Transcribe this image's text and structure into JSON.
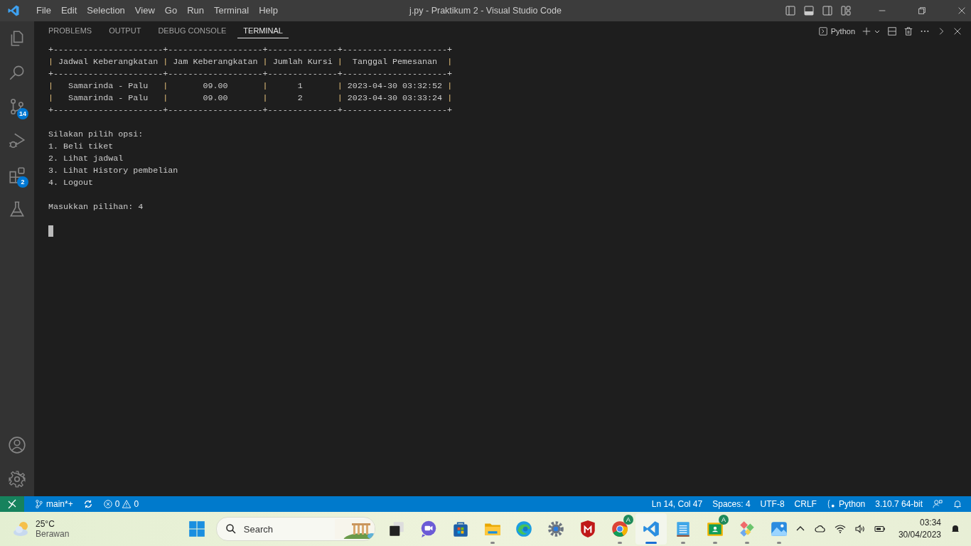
{
  "window": {
    "title": "j.py - Praktikum 2 - Visual Studio Code"
  },
  "menu": [
    "File",
    "Edit",
    "Selection",
    "View",
    "Go",
    "Run",
    "Terminal",
    "Help"
  ],
  "activity_bar": {
    "items": [
      {
        "kind": "explorer"
      },
      {
        "kind": "search"
      },
      {
        "kind": "source-control",
        "badge": "14"
      },
      {
        "kind": "run"
      },
      {
        "kind": "extensions",
        "badge": "2"
      },
      {
        "kind": "testing"
      }
    ],
    "bottom": [
      {
        "kind": "account"
      },
      {
        "kind": "settings"
      }
    ]
  },
  "panel_tabs": [
    {
      "label": "PROBLEMS",
      "selected": false
    },
    {
      "label": "OUTPUT",
      "selected": false
    },
    {
      "label": "DEBUG CONSOLE",
      "selected": false
    },
    {
      "label": "TERMINAL",
      "selected": true
    }
  ],
  "terminal_profile": "Python",
  "terminal": {
    "blocks": [
      [
        [
          {
            "kind": "plain",
            "text": "+----------------------+-------------------+--------------+---------------------+"
          }
        ],
        [
          {
            "kind": "border",
            "text": "|"
          },
          {
            "kind": "plain",
            "text": " Jadwal Keberangkatan "
          },
          {
            "kind": "border",
            "text": "|"
          },
          {
            "kind": "plain",
            "text": " Jam Keberangkatan "
          },
          {
            "kind": "border",
            "text": "|"
          },
          {
            "kind": "plain",
            "text": " Jumlah Kursi "
          },
          {
            "kind": "border",
            "text": "|"
          },
          {
            "kind": "plain",
            "text": "  Tanggal Pemesanan  "
          },
          {
            "kind": "border",
            "text": "|"
          }
        ],
        [
          {
            "kind": "plain",
            "text": "+----------------------+-------------------+--------------+---------------------+"
          }
        ],
        [
          {
            "kind": "border",
            "text": "|"
          },
          {
            "kind": "plain",
            "text": "   Samarinda - Palu   "
          },
          {
            "kind": "border",
            "text": "|"
          },
          {
            "kind": "plain",
            "text": "       09.00       "
          },
          {
            "kind": "border",
            "text": "|"
          },
          {
            "kind": "plain",
            "text": "      1       "
          },
          {
            "kind": "border",
            "text": "|"
          },
          {
            "kind": "plain",
            "text": " 2023-04-30 03:32:52 "
          },
          {
            "kind": "border",
            "text": "|"
          }
        ],
        [
          {
            "kind": "border",
            "text": "|"
          },
          {
            "kind": "plain",
            "text": "   Samarinda - Palu   "
          },
          {
            "kind": "border",
            "text": "|"
          },
          {
            "kind": "plain",
            "text": "       09.00       "
          },
          {
            "kind": "border",
            "text": "|"
          },
          {
            "kind": "plain",
            "text": "      2       "
          },
          {
            "kind": "border",
            "text": "|"
          },
          {
            "kind": "plain",
            "text": " 2023-04-30 03:33:24 "
          },
          {
            "kind": "border",
            "text": "|"
          }
        ],
        [
          {
            "kind": "plain",
            "text": "+----------------------+-------------------+--------------+---------------------+"
          }
        ]
      ],
      [
        [
          {
            "kind": "plain",
            "text": "Silakan pilih opsi:"
          }
        ],
        [
          {
            "kind": "plain",
            "text": "1. Beli tiket"
          }
        ],
        [
          {
            "kind": "plain",
            "text": "2. Lihat jadwal"
          }
        ],
        [
          {
            "kind": "plain",
            "text": "3. Lihat History pembelian"
          }
        ],
        [
          {
            "kind": "plain",
            "text": "4. Logout"
          }
        ]
      ],
      [
        [
          {
            "kind": "plain",
            "text": "Masukkan pilihan: 4"
          }
        ]
      ]
    ]
  },
  "status_bar": {
    "branch": "main*+",
    "errors": "0",
    "warnings": "0",
    "right": [
      {
        "kind": "text",
        "text": "Ln 14, Col 47"
      },
      {
        "kind": "text",
        "text": "Spaces: 4"
      },
      {
        "kind": "text",
        "text": "UTF-8"
      },
      {
        "kind": "text",
        "text": "CRLF"
      },
      {
        "kind": "language",
        "text": "Python"
      },
      {
        "kind": "text",
        "text": "3.10.7 64-bit"
      }
    ]
  },
  "taskbar": {
    "weather": {
      "temp": "25°C",
      "condition": "Berawan"
    },
    "search": {
      "placeholder": "Search"
    },
    "apps": [
      {
        "kind": "task-view",
        "running": false,
        "active": false
      },
      {
        "kind": "meet",
        "running": false,
        "active": false
      },
      {
        "kind": "store",
        "running": false,
        "active": false
      },
      {
        "kind": "folder",
        "running": true,
        "active": false
      },
      {
        "kind": "edge",
        "running": false,
        "active": false
      },
      {
        "kind": "settings",
        "running": false,
        "active": false
      },
      {
        "kind": "shield",
        "running": false,
        "active": false
      },
      {
        "kind": "chrome",
        "running": true,
        "active": false,
        "badge": "A"
      },
      {
        "kind": "vscode",
        "running": true,
        "active": true
      },
      {
        "kind": "notepad",
        "running": true,
        "active": false
      },
      {
        "kind": "classroom",
        "running": true,
        "active": false,
        "badge": "A"
      },
      {
        "kind": "gems",
        "running": true,
        "active": false
      },
      {
        "kind": "photos",
        "running": true,
        "active": false
      }
    ],
    "clock": {
      "time": "03:34",
      "date": "30/04/2023"
    }
  }
}
